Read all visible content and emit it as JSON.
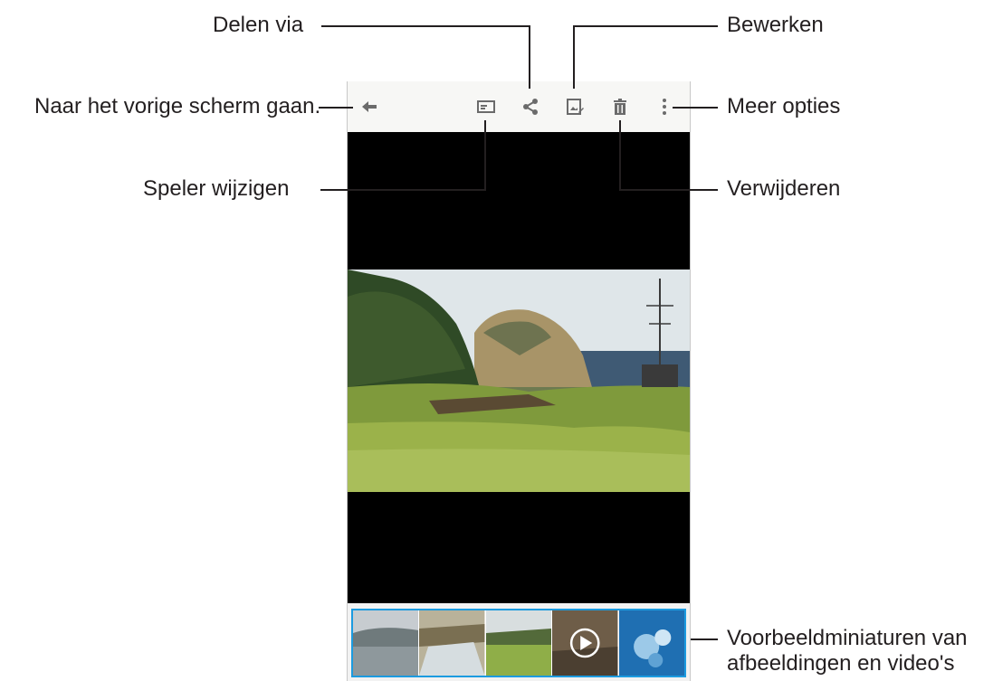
{
  "callouts": {
    "share": "Delen via",
    "edit": "Bewerken",
    "back": "Naar het vorige scherm gaan.",
    "more": "Meer opties",
    "player": "Speler wijzigen",
    "delete": "Verwijderen",
    "thumbs_line1": "Voorbeeldminiaturen van",
    "thumbs_line2": "afbeeldingen en video's"
  },
  "actionbar": {
    "icons": [
      "back-arrow-icon",
      "change-player-icon",
      "share-icon",
      "edit-icon",
      "trash-icon",
      "more-options-icon"
    ]
  },
  "filmstrip": {
    "thumbnails": [
      "landscape-lake",
      "river-bank",
      "green-field",
      "video-play",
      "blue-nature"
    ]
  },
  "colors": {
    "accent": "#1c9be0",
    "text": "#231f20",
    "icon": "#6b6b6b"
  }
}
